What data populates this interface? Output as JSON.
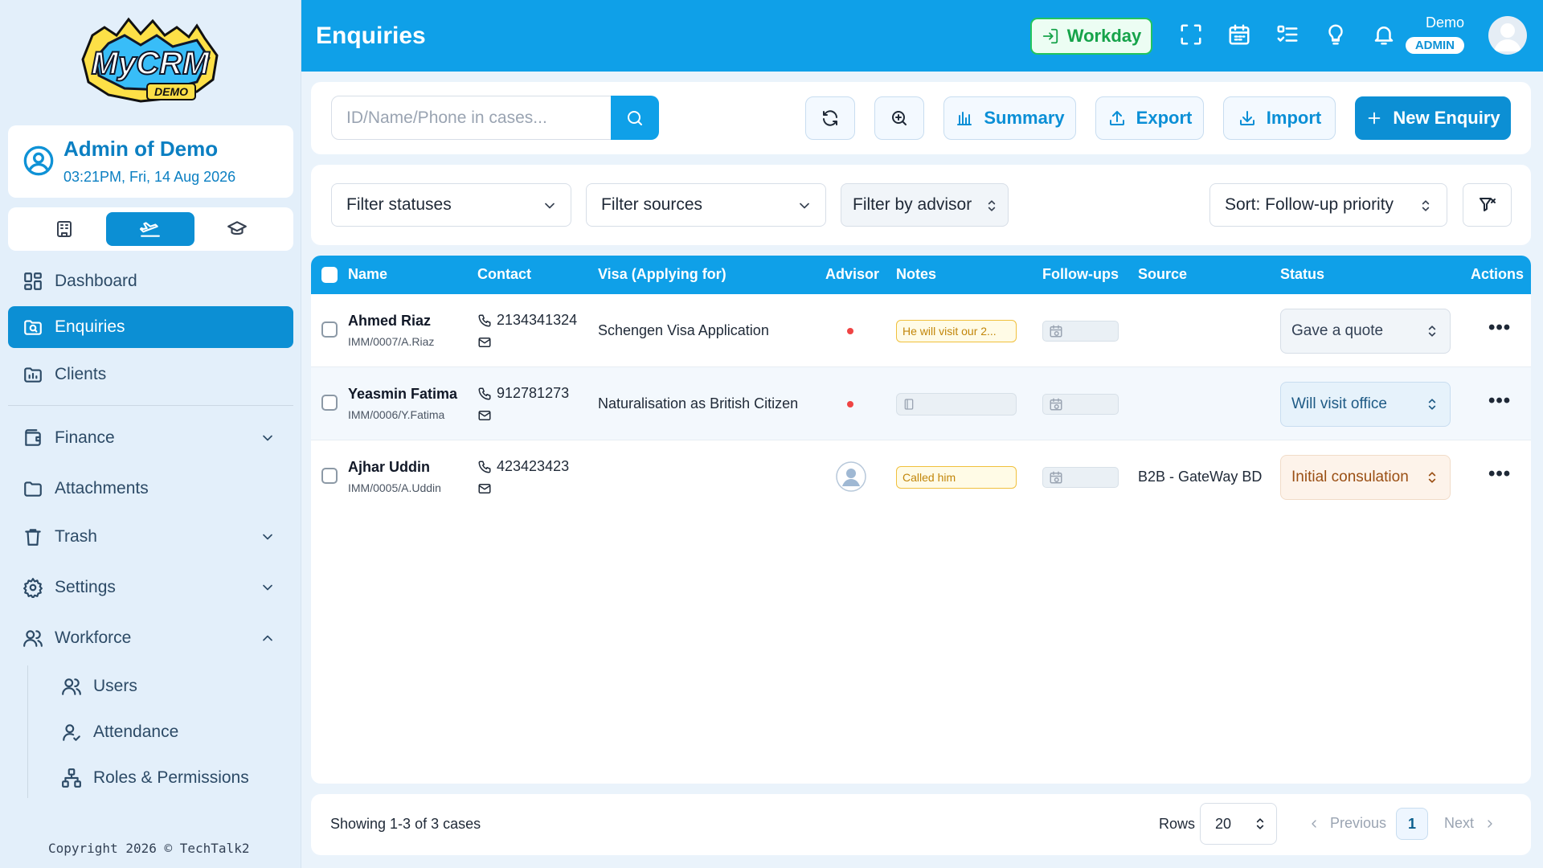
{
  "app": {
    "page_title": "Enquiries",
    "logo_text": "MyCRM",
    "logo_sub": "DEMO",
    "copyright": "Copyright 2026 © TechTalk2"
  },
  "profile": {
    "name": "Admin of Demo",
    "datetime": "03:21PM, Fri, 14 Aug 2026"
  },
  "header": {
    "workday_label": "Workday",
    "user_name": "Demo",
    "user_role": "ADMIN",
    "icons": [
      "fullscreen-icon",
      "calendar-icon",
      "checklist-icon",
      "lightbulb-icon",
      "bell-icon"
    ]
  },
  "sidebar": {
    "modes": [
      "building-icon",
      "plane-icon",
      "graduation-cap-icon"
    ],
    "items": [
      {
        "label": "Dashboard",
        "icon": "dashboard-icon"
      },
      {
        "label": "Enquiries",
        "icon": "enquiries-icon"
      },
      {
        "label": "Clients",
        "icon": "clients-icon"
      },
      {
        "label": "Finance",
        "icon": "wallet-icon"
      },
      {
        "label": "Attachments",
        "icon": "folder-icon"
      },
      {
        "label": "Trash",
        "icon": "trash-icon"
      },
      {
        "label": "Settings",
        "icon": "gear-icon"
      },
      {
        "label": "Workforce",
        "icon": "users-icon"
      }
    ],
    "workforce_children": [
      {
        "label": "Users"
      },
      {
        "label": "Attendance"
      },
      {
        "label": "Roles & Permissions"
      }
    ]
  },
  "toolbar": {
    "search_placeholder": "ID/Name/Phone in cases...",
    "summary_label": "Summary",
    "export_label": "Export",
    "import_label": "Import",
    "new_label": "New Enquiry"
  },
  "filters": {
    "statuses": "Filter statuses",
    "sources": "Filter sources",
    "advisor": "Filter by advisor",
    "sort": "Sort: Follow-up priority"
  },
  "table": {
    "columns": [
      "Name",
      "Contact",
      "Visa (Applying for)",
      "Advisor",
      "Notes",
      "Follow-ups",
      "Source",
      "Status",
      "Actions"
    ],
    "rows": [
      {
        "name": "Ahmed Riaz",
        "ref": "IMM/0007/A.Riaz",
        "phone": "2134341324",
        "visa": "Schengen Visa Application",
        "note": "He will visit our 2...",
        "source": "",
        "status": "Gave a quote",
        "status_bg": "#f1f5f9",
        "status_border": "#d7dee7",
        "status_color": "#334155"
      },
      {
        "name": "Yeasmin Fatima",
        "ref": "IMM/0006/Y.Fatima",
        "phone": "912781273",
        "visa": "Naturalisation as British Citizen",
        "note": "",
        "source": "",
        "status": "Will visit office",
        "status_bg": "#e6f2fb",
        "status_border": "#c8ddf0",
        "status_color": "#1e5a85"
      },
      {
        "name": "Ajhar Uddin",
        "ref": "IMM/0005/A.Uddin",
        "phone": "423423423",
        "visa": "",
        "note": "Called him",
        "source": "B2B - GateWay BD",
        "status": "Initial consulation",
        "status_bg": "#fdf3ea",
        "status_border": "#f1dcc8",
        "status_color": "#9a4f14"
      }
    ]
  },
  "footer": {
    "showing": "Showing 1-3 of 3 cases",
    "rows_label": "Rows",
    "rows_value": "20",
    "prev": "Previous",
    "page": "1",
    "next": "Next"
  }
}
